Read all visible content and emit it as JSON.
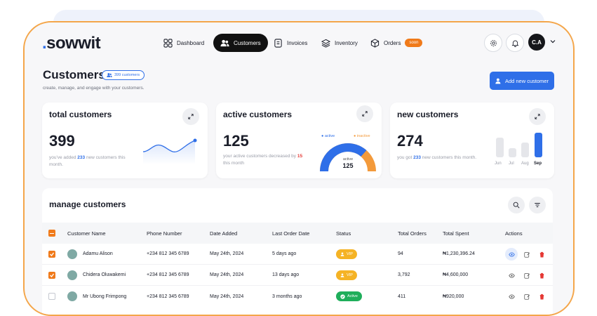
{
  "logo": {
    "text": "sowwit"
  },
  "nav": [
    {
      "label": "Dashboard",
      "icon": "grid-icon"
    },
    {
      "label": "Customers",
      "icon": "users-icon",
      "active": true
    },
    {
      "label": "Invoices",
      "icon": "invoice-icon"
    },
    {
      "label": "Inventory",
      "icon": "layers-icon"
    },
    {
      "label": "Orders",
      "icon": "box-icon",
      "badge": "soon"
    }
  ],
  "user": {
    "initials": "C.A"
  },
  "page": {
    "title": "Customers",
    "badge": "399 customers",
    "subtitle": "create, manage, and engage with your customers.",
    "add_button": "Add new customer"
  },
  "cards": {
    "total": {
      "title": "total customers",
      "value": "399",
      "desc_pre": "you've added ",
      "desc_num": "233",
      "desc_post": " new customers this month."
    },
    "active": {
      "title": "active customers",
      "value": "125",
      "desc_pre": "your active customers decreased by ",
      "desc_num": "15",
      "desc_post": " this month",
      "legend_active": "active",
      "legend_inactive": "inactive",
      "gauge_label": "active",
      "gauge_value": "125",
      "active_fraction": 0.73
    },
    "new": {
      "title": "new customers",
      "value": "274",
      "desc_pre": "you got ",
      "desc_num": "233",
      "desc_post": " new customers this month.",
      "bars": [
        {
          "label": "Jun"
        },
        {
          "label": "Jul"
        },
        {
          "label": "Aug"
        },
        {
          "label": "Sep"
        }
      ]
    }
  },
  "table": {
    "title": "manage customers",
    "columns": [
      "Customer Name",
      "Phone Number",
      "Date Added",
      "Last Order Date",
      "Status",
      "Total Orders",
      "Total Spent",
      "Actions"
    ],
    "rows": [
      {
        "name": "Adamu Alison",
        "phone": "+234 812 345 6789",
        "date_added": "May 24th, 2024",
        "last_order": "5 days ago",
        "status": "VIP",
        "orders": "94",
        "spent": "₦1,230,396.24",
        "checked": true
      },
      {
        "name": "Chidera Oluwakemi",
        "phone": "+234 812 345 6789",
        "date_added": "May 24th, 2024",
        "last_order": "13 days ago",
        "status": "VIP",
        "orders": "3,792",
        "spent": "₦4,600,000",
        "checked": true
      },
      {
        "name": "Mr Ubong Frimpong",
        "phone": "+234 812 345 6789",
        "date_added": "May 24th, 2024",
        "last_order": "3 months ago",
        "status": "Active",
        "orders": "411",
        "spent": "₦920,000",
        "checked": false
      }
    ]
  },
  "colors": {
    "accent": "#2f6fe8",
    "orange": "#f07a1a",
    "frame": "#f4a64a"
  }
}
